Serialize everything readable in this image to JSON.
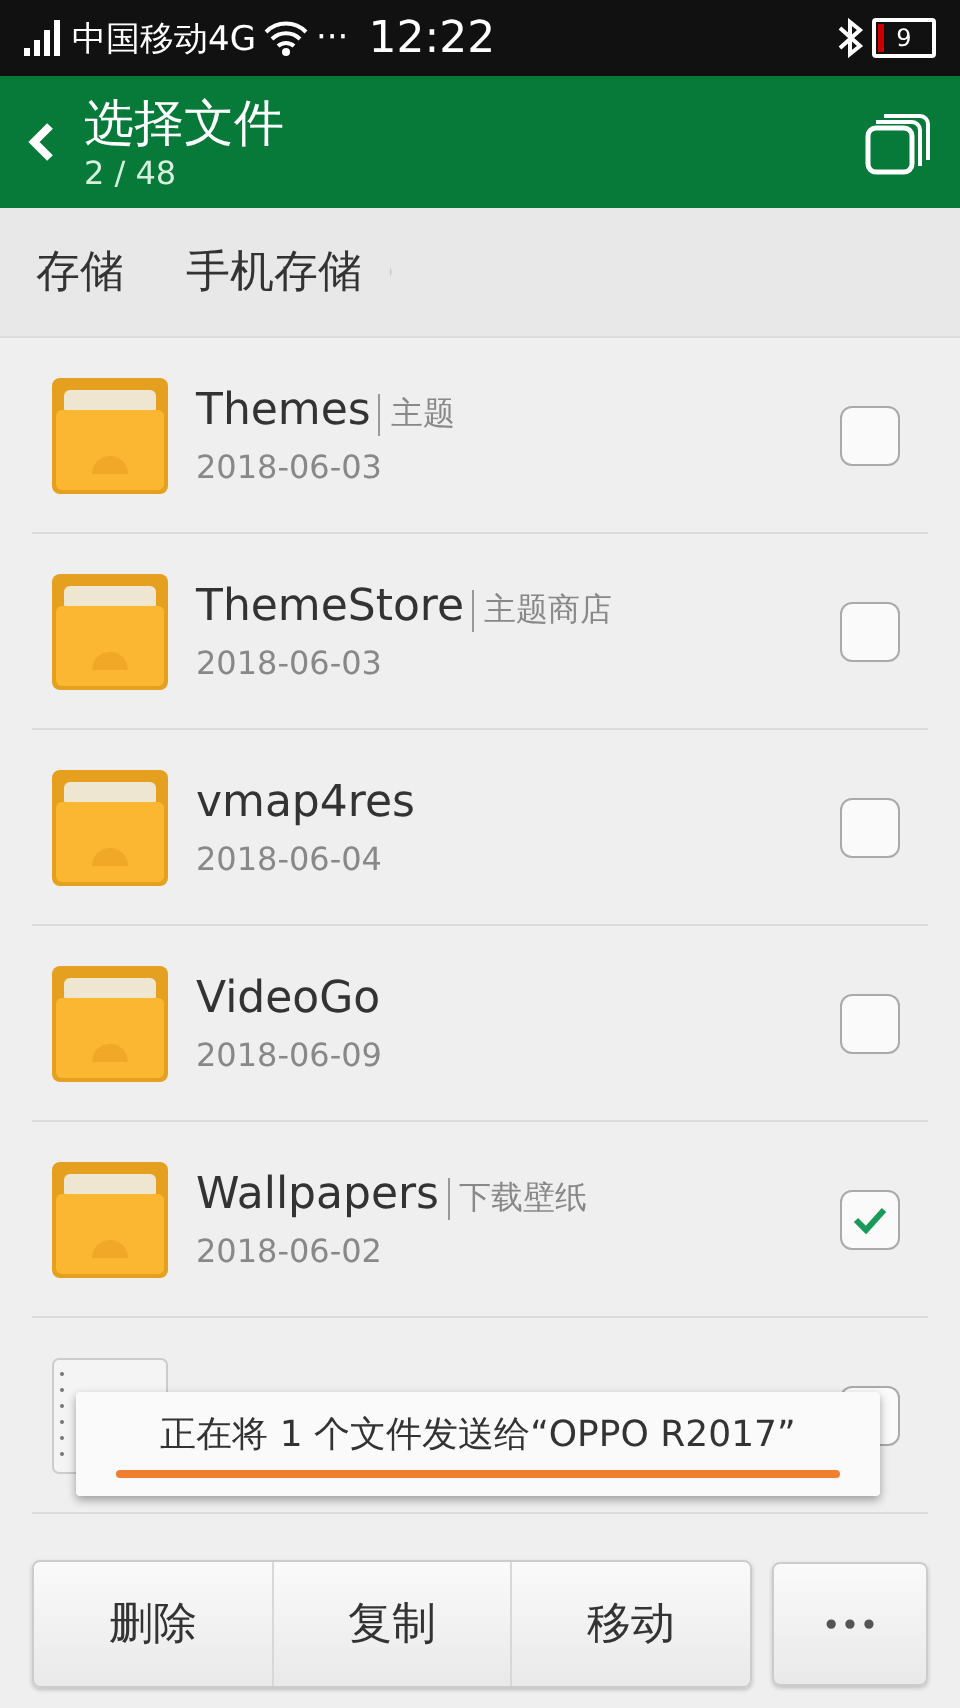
{
  "status_bar": {
    "carrier": "中国移动4G",
    "dots": "···",
    "time": "12:22",
    "battery": "9"
  },
  "header": {
    "title": "选择文件",
    "count": "2 / 48"
  },
  "breadcrumbs": [
    {
      "label": "存储"
    },
    {
      "label": "手机存储"
    }
  ],
  "files": [
    {
      "kind": "folder",
      "name": "Themes",
      "alias": "主题",
      "date": "2018-06-03",
      "checked": false
    },
    {
      "kind": "folder",
      "name": "ThemeStore",
      "alias": "主题商店",
      "date": "2018-06-03",
      "checked": false
    },
    {
      "kind": "folder",
      "name": "vmap4res",
      "date": "2018-06-04",
      "checked": false
    },
    {
      "kind": "folder",
      "name": "VideoGo",
      "date": "2018-06-09",
      "checked": false
    },
    {
      "kind": "folder",
      "name": "Wallpapers",
      "alias": "下载壁纸",
      "date": "2018-06-02",
      "checked": true
    },
    {
      "kind": "file",
      "checked": false
    }
  ],
  "toast": {
    "text": "正在将 1 个文件发送给“OPPO R2017”"
  },
  "actions": [
    "删除",
    "复制",
    "移动"
  ],
  "more": "•••"
}
